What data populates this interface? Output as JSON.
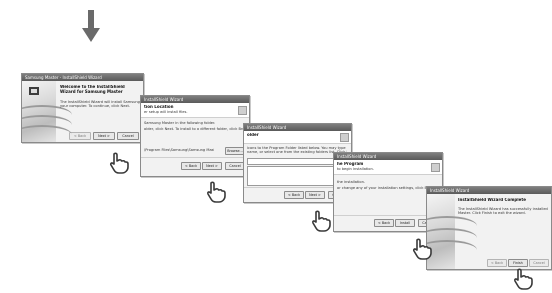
{
  "windows": [
    {
      "title": "Samsung Master - InstallShield Wizard",
      "heading": "Welcome to the InstallShield Wizard for Samsung Master",
      "body": [
        "The InstallShield Wizard will install Samsung Master on",
        "your computer. To continue, click Next."
      ],
      "buttons": [
        "< Back",
        "Next >",
        "Cancel"
      ]
    },
    {
      "title": "InstallShield Wizard",
      "heading": "tion Location",
      "subheading": "er setup will install files.",
      "body": [
        "Samsung Master in the following folder.",
        "older, click Next. To install to a different folder, click Browse and select"
      ],
      "path": "\\Program Files\\Samsung\\Samsung Master",
      "buttons": [
        "Browse...",
        "< Back",
        "Next >",
        "Cancel"
      ]
    },
    {
      "title": "InstallShield Wizard",
      "heading": "older",
      "body": [
        "icons to the Program Folder listed below. You may type a new folder",
        "name, or select one from the existing folders list. Click Next to continue."
      ],
      "buttons": [
        "< Back",
        "Next >",
        "Cancel"
      ]
    },
    {
      "title": "InstallShield Wizard",
      "heading": "he Program",
      "subheading": "to begin installation.",
      "body": [
        "the installation.",
        "or change any of your installation settings, click Back. Click Cancel to exit"
      ],
      "buttons": [
        "< Back",
        "Install",
        "Cancel"
      ]
    },
    {
      "title": "InstallShield Wizard",
      "heading": "InstallShield Wizard Complete",
      "body": [
        "The InstallShield Wizard has successfully installed Samsung",
        "Master. Click Finish to exit the wizard."
      ],
      "buttons": [
        "< Back",
        "Finish",
        "Cancel"
      ]
    }
  ],
  "icons": {
    "step_arrow": "down-arrow-icon",
    "pointer": "hand-cursor-icon"
  },
  "colors": {
    "titlebar": "#666666",
    "window_bg": "#f2f2f2",
    "arrow": "#6a6a6a"
  }
}
